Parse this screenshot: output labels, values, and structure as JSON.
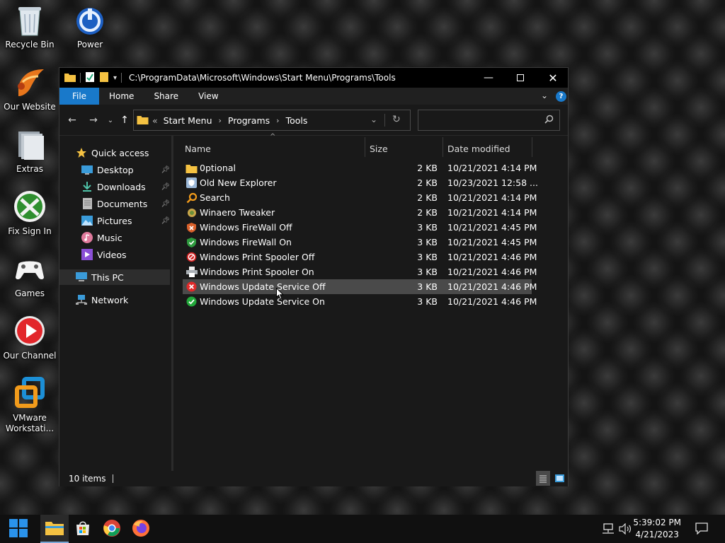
{
  "desktop": {
    "icons": [
      {
        "label": "Recycle Bin",
        "icon": "recycle-bin-icon"
      },
      {
        "label": "Power",
        "icon": "power-icon"
      },
      {
        "label": "Our Website",
        "icon": "website-icon"
      },
      {
        "label": "Extras",
        "icon": "folder-stack-icon"
      },
      {
        "label": "Fix Sign In",
        "icon": "xbox-icon"
      },
      {
        "label": "Games",
        "icon": "gamepad-icon"
      },
      {
        "label": "Our Channel",
        "icon": "play-icon"
      },
      {
        "label": "VMware\nWorkstati...",
        "icon": "vmware-icon"
      }
    ]
  },
  "window": {
    "title_path": "C:\\ProgramData\\Microsoft\\Windows\\Start Menu\\Programs\\Tools",
    "ribbon_tabs": [
      "File",
      "Home",
      "Share",
      "View"
    ],
    "breadcrumb": [
      "Start Menu",
      "Programs",
      "Tools"
    ],
    "breadcrumb_overflow": "«",
    "search_placeholder": "",
    "nav_items": [
      {
        "label": "Quick access",
        "icon": "star-icon",
        "pinned": false
      },
      {
        "label": "Desktop",
        "icon": "desktop-icon",
        "pinned": true
      },
      {
        "label": "Downloads",
        "icon": "download-icon",
        "pinned": true
      },
      {
        "label": "Documents",
        "icon": "document-icon",
        "pinned": true
      },
      {
        "label": "Pictures",
        "icon": "picture-icon",
        "pinned": true
      },
      {
        "label": "Music",
        "icon": "music-icon",
        "pinned": false
      },
      {
        "label": "Videos",
        "icon": "video-icon",
        "pinned": false
      },
      {
        "label": "This PC",
        "icon": "computer-icon",
        "pinned": false
      },
      {
        "label": "Network",
        "icon": "network-icon",
        "pinned": false
      }
    ],
    "columns": {
      "name": "Name",
      "size": "Size",
      "date": "Date modified"
    },
    "files": [
      {
        "name": "0ptional",
        "size": "2 KB",
        "date": "10/21/2021 4:14 PM",
        "icon": "folder-icon"
      },
      {
        "name": "Old New Explorer",
        "size": "2 KB",
        "date": "10/23/2021 12:58 ...",
        "icon": "shield-icon"
      },
      {
        "name": "Search",
        "size": "2 KB",
        "date": "10/21/2021 4:14 PM",
        "icon": "search-icon"
      },
      {
        "name": "Winaero Tweaker",
        "size": "2 KB",
        "date": "10/21/2021 4:14 PM",
        "icon": "tweaker-icon"
      },
      {
        "name": "Windows FireWall Off",
        "size": "3 KB",
        "date": "10/21/2021 4:45 PM",
        "icon": "firewall-off-icon"
      },
      {
        "name": "Windows FireWall On",
        "size": "3 KB",
        "date": "10/21/2021 4:45 PM",
        "icon": "firewall-on-icon"
      },
      {
        "name": "Windows Print Spooler Off",
        "size": "3 KB",
        "date": "10/21/2021 4:46 PM",
        "icon": "block-icon"
      },
      {
        "name": "Windows Print Spooler On",
        "size": "3 KB",
        "date": "10/21/2021 4:46 PM",
        "icon": "printer-icon"
      },
      {
        "name": "Windows Update Service Off",
        "size": "3 KB",
        "date": "10/21/2021 4:46 PM",
        "icon": "error-icon",
        "selected": true
      },
      {
        "name": "Windows Update Service On",
        "size": "3 KB",
        "date": "10/21/2021 4:46 PM",
        "icon": "check-icon"
      }
    ],
    "status": {
      "item_count": "10 items"
    }
  },
  "taskbar": {
    "time": "5:39:02 PM",
    "date": "4/21/2023"
  },
  "colors": {
    "accent": "#1979ca",
    "selection": "#4a4a4a",
    "window_bg": "#191919"
  }
}
